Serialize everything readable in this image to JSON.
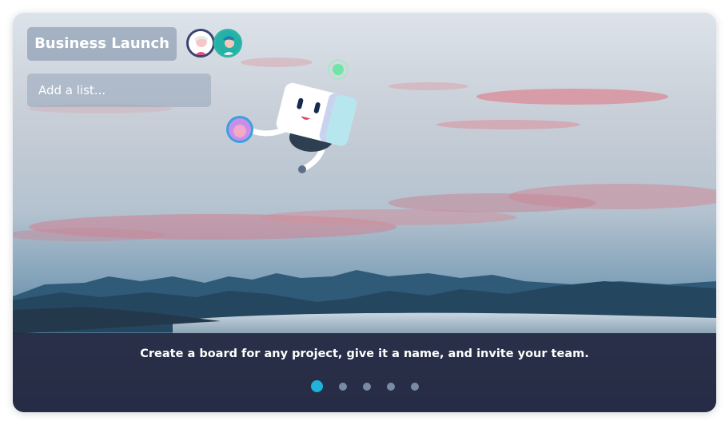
{
  "board": {
    "title": "Business Launch",
    "add_list_placeholder": "Add a list..."
  },
  "members": [
    {
      "name": "member-avatar-1"
    },
    {
      "name": "member-avatar-2"
    }
  ],
  "carousel": {
    "caption": "Create a board for any project, give it a name, and invite your team.",
    "active_index": 0,
    "slide_count": 5
  },
  "colors": {
    "accent_dot": "#1fb3dc",
    "inactive_dot": "#7a8aa6",
    "caption_bar": "#24263e"
  },
  "icons": [
    "robot-mascot-icon",
    "member-avatar-icon",
    "held-avatar-icon",
    "signal-ring-icon"
  ]
}
